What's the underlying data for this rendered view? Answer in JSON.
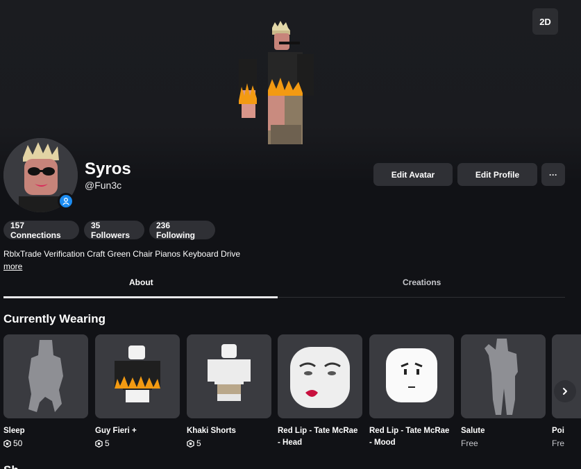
{
  "header": {
    "toggle_2d_label": "2D",
    "display_name": "Syros",
    "username": "@Fun3c",
    "edit_avatar_label": "Edit Avatar",
    "edit_profile_label": "Edit Profile",
    "more_options_label": "···"
  },
  "stats": {
    "connections": "157 Connections",
    "followers": "35 Followers",
    "following": "236 Following"
  },
  "about": {
    "description": "RblxTrade Verification Craft Green Chair Pianos Keyboard Drive",
    "more_label": "more"
  },
  "tabs": [
    {
      "label": "About",
      "active": true
    },
    {
      "label": "Creations",
      "active": false
    }
  ],
  "currently_wearing": {
    "title": "Currently Wearing",
    "items": [
      {
        "name": "Sleep",
        "price": "50",
        "free": false
      },
      {
        "name": "Guy Fieri +",
        "price": "5",
        "free": false
      },
      {
        "name": "Khaki Shorts",
        "price": "5",
        "free": false
      },
      {
        "name": "Red Lip - Tate McRae - Head",
        "price": "",
        "free": false
      },
      {
        "name": "Red Lip - Tate McRae - Mood",
        "price": "",
        "free": false
      },
      {
        "name": "Salute",
        "price": "Free",
        "free": true
      },
      {
        "name": "Poi",
        "price": "Fre",
        "free": true
      }
    ]
  },
  "colors": {
    "background": "#111216",
    "button": "#2f3035",
    "presence": "#1c8cf1",
    "flame": "#f39a12"
  },
  "icons": {
    "presence": "person-icon",
    "currency": "robux-icon",
    "next": "chevron-right-icon"
  },
  "next_section_partial": "Sh"
}
